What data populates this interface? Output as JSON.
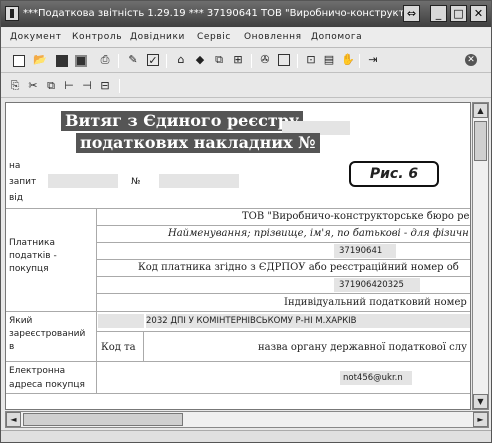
{
  "window": {
    "title": "***Податкова звітність 1.29.19 *** 37190641 ТОВ \"Виробничо-конструкто",
    "buttons": {
      "restore": "⇔",
      "minimize": "_",
      "maximize": "□",
      "close": "✕"
    }
  },
  "menu": {
    "items": [
      "Документ",
      "Контроль",
      "Довідники",
      "Сервіс",
      "Оновлення",
      "Допомога"
    ]
  },
  "toolbar1": {
    "icons": [
      "new-doc-icon",
      "open-folder-icon",
      "save-icon",
      "save-all-icon",
      "print-icon",
      "sign-icon",
      "check-icon",
      "print-preview-icon",
      "send-icon",
      "copy-icon",
      "export-icon",
      "tools-icon",
      "page-icon",
      "form-icon",
      "properties-icon",
      "help-icon",
      "exit-icon",
      "close-doc-icon"
    ]
  },
  "toolbar2": {
    "icons": [
      "paste-icon",
      "cut-icon",
      "copy-rows-icon",
      "insert-row-icon",
      "add-row-icon",
      "delete-row-icon"
    ]
  },
  "form": {
    "heading_line1": "Витяг з Єдиного реєстру",
    "heading_line2": "податкових накладних №",
    "request_label_1": "на",
    "request_label_2": "запит",
    "request_label_3": "від",
    "number_sign": "№",
    "fig_label": "Рис. 6",
    "payer_label_1": "Платника",
    "payer_label_2": "податків -",
    "payer_label_3": "покупця",
    "company_name": "ТОВ \"Виробничо-конструкторське бюро ре",
    "name_hint": "Найменування; прізвище, ім'я, по батькові - для фізичн",
    "edrpou_value": "37190641",
    "edrpou_hint": "Код платника згідно з ЄДРПОУ або реєстраційний номер об",
    "ipn_value": "371906420325",
    "ipn_hint": "Індивідуальний податковий номер",
    "registered_label_1": "Який",
    "registered_label_2": "зареєстрований",
    "registered_label_3": "в",
    "tax_office": "2032 ДПІ У КОМІНТЕРНІВСЬКОМУ Р-НІ М.ХАРКІВ",
    "code_label": "Код та",
    "office_hint": "назва органу державної податкової слу",
    "email_label_1": "Електронна",
    "email_label_2": "адреса покупця",
    "email_value": "not456@ukr.n"
  },
  "scroll": {
    "up": "▲",
    "down": "▼",
    "left": "◄",
    "right": "►"
  }
}
